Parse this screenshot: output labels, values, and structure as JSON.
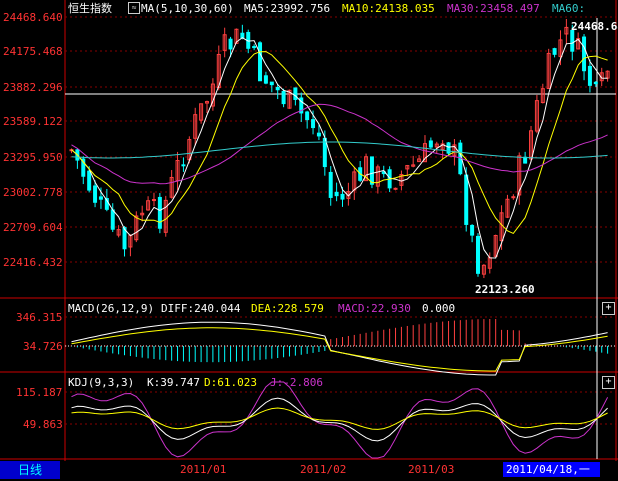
{
  "title": "恒生指数",
  "colors": {
    "bg": "#000000",
    "axis": "#ff0000",
    "up": "#ff4040",
    "down": "#00ffff",
    "ma5": "#ffffff",
    "ma10": "#ffff00",
    "ma30": "#cc33cc",
    "ma60": "#33cccc",
    "diff": "#ffffff",
    "dea": "#ffff00",
    "macd_pos": "#ff4040",
    "macd_neg": "#00ffff",
    "k": "#ffffff",
    "d": "#ffff00",
    "j": "#cc33cc"
  },
  "header": {
    "ma_label": "MA(5,10,30,60)",
    "ma5": "MA5:23992.756",
    "ma10": "MA10:24138.035",
    "ma30": "MA30:23458.497",
    "ma60": "MA60:"
  },
  "price_axis": [
    "24468.640",
    "24175.468",
    "23882.296",
    "23589.122",
    "23295.950",
    "23002.778",
    "22709.604",
    "22416.432"
  ],
  "annotations": {
    "high": "24468.640",
    "low": "22123.260"
  },
  "macd": {
    "label": "MACD(26,12,9)",
    "diff": "DIFF:240.044",
    "dea": "DEA:228.579",
    "macd": "MACD:22.930",
    "zero": "0.000",
    "axis": [
      "346.315",
      "34.726"
    ]
  },
  "kdj": {
    "label": "KDJ(9,3,3)",
    "k": "K:39.747",
    "d": "D:61.023",
    "j": "J:-2.806",
    "axis": [
      "115.187",
      "49.863"
    ]
  },
  "time_axis": [
    "2011/01",
    "2011/02",
    "2011/03"
  ],
  "cursor_date": "2011/04/18,一",
  "period_tab": "日线",
  "buttons": {
    "plus": "+"
  }
}
